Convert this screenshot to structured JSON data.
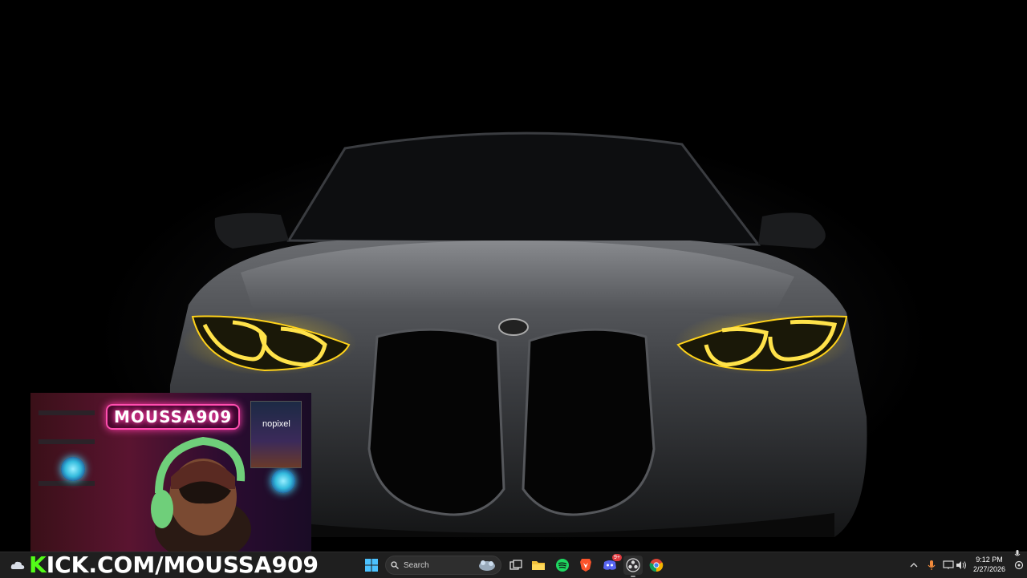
{
  "desktop": {
    "wallpaper_subject": "bmw-m4-front-yellow-headlights"
  },
  "overlay": {
    "channel_sign": "MOUSSA909",
    "poster_text": "nopixel",
    "kick_banner_k": "K",
    "kick_banner_rest": "ICK.COM/MOUSSA909"
  },
  "taskbar": {
    "search_label": "Search",
    "pinned": [
      {
        "name": "task-view-icon"
      },
      {
        "name": "file-explorer-icon"
      },
      {
        "name": "spotify-icon"
      },
      {
        "name": "brave-icon"
      },
      {
        "name": "discord-icon",
        "badge": "9+"
      },
      {
        "name": "obs-icon"
      },
      {
        "name": "chrome-icon"
      }
    ],
    "tray": {
      "time": "9:12 PM",
      "date": "2/27/2026"
    }
  },
  "colors": {
    "headlight": "#ffd21a",
    "kick_green": "#53fc18",
    "neon_pink": "#ff3fa8",
    "taskbar": "#1f1f1f"
  }
}
